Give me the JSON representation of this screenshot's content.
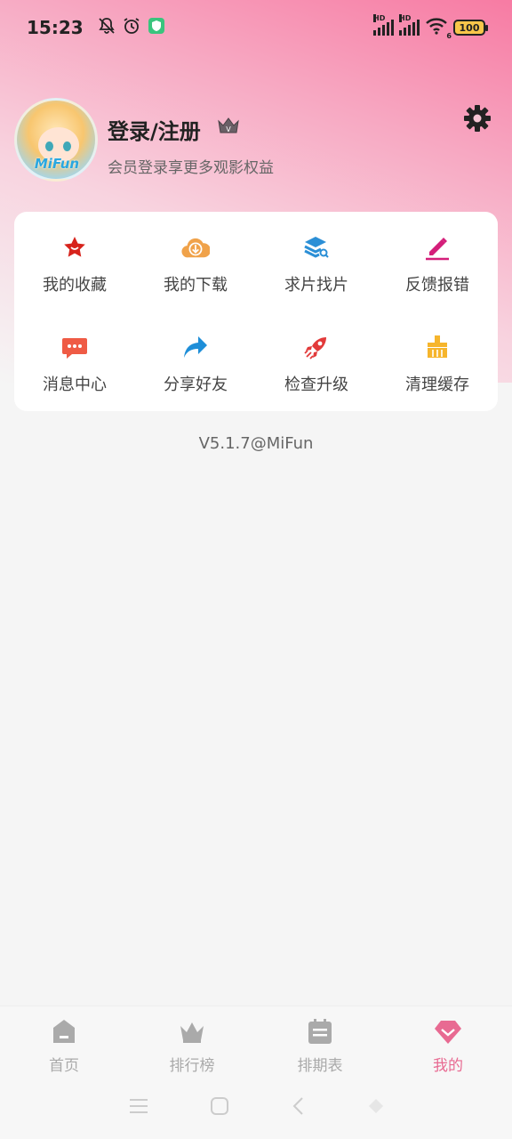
{
  "status_bar": {
    "time": "15:23",
    "network_label": "HD",
    "wifi_label": "6",
    "battery": "100"
  },
  "profile": {
    "avatar_text": "MiFun",
    "login_title": "登录/注册",
    "subtitle": "会员登录享更多观影权益",
    "crown_letter": "V"
  },
  "menu": {
    "items": [
      {
        "label": "我的收藏",
        "icon": "star-icon",
        "color": "#d7231c"
      },
      {
        "label": "我的下载",
        "icon": "cloud-download-icon",
        "color": "#f0a24a"
      },
      {
        "label": "求片找片",
        "icon": "stack-search-icon",
        "color": "#2b8fd6"
      },
      {
        "label": "反馈报错",
        "icon": "pencil-icon",
        "color": "#d41f7a"
      },
      {
        "label": "消息中心",
        "icon": "message-icon",
        "color": "#ef5b45"
      },
      {
        "label": "分享好友",
        "icon": "share-icon",
        "color": "#1e8ed8"
      },
      {
        "label": "检查升级",
        "icon": "rocket-icon",
        "color": "#e23a3a"
      },
      {
        "label": "清理缓存",
        "icon": "broom-icon",
        "color": "#f6b52c"
      }
    ]
  },
  "version": "V5.1.7@MiFun",
  "tabbar": {
    "tabs": [
      {
        "label": "首页",
        "icon": "home-icon"
      },
      {
        "label": "排行榜",
        "icon": "crown-icon"
      },
      {
        "label": "排期表",
        "icon": "calendar-icon"
      },
      {
        "label": "我的",
        "icon": "heart-gem-icon",
        "active": true
      }
    ],
    "active_color": "#e86a92",
    "inactive_color": "#aaaaaa"
  }
}
